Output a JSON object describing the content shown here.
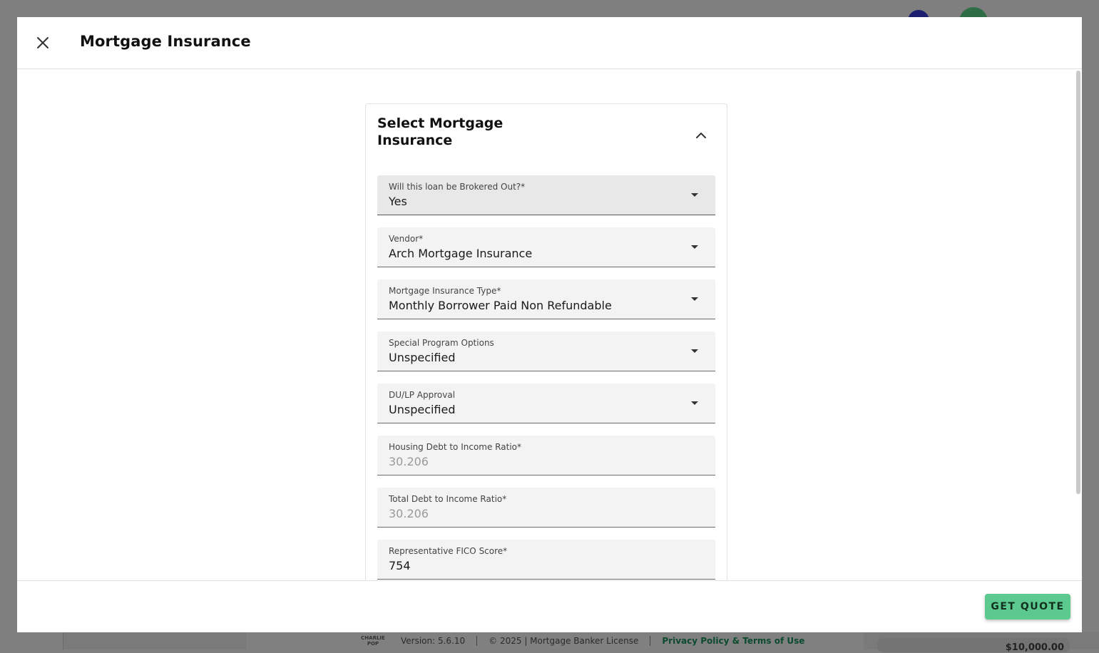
{
  "dialog": {
    "title": "Mortgage Insurance",
    "close_icon": "close-icon"
  },
  "card": {
    "title": "Select Mortgage Insurance",
    "collapse_icon": "chevron-up-icon"
  },
  "fields": {
    "brokered": {
      "label": "Will this loan be Brokered Out?*",
      "value": "Yes"
    },
    "vendor": {
      "label": "Vendor*",
      "value": "Arch Mortgage Insurance"
    },
    "mi_type": {
      "label": "Mortgage Insurance Type*",
      "value": "Monthly Borrower Paid Non Refundable"
    },
    "special_program": {
      "label": "Special Program Options",
      "value": "Unspecified"
    },
    "du_lp": {
      "label": "DU/LP Approval",
      "value": "Unspecified"
    },
    "housing_dti": {
      "label": "Housing Debt to Income Ratio*",
      "value": "30.206"
    },
    "total_dti": {
      "label": "Total Debt to Income Ratio*",
      "value": "30.206"
    },
    "fico": {
      "label": "Representative FICO Score*",
      "value": "754"
    }
  },
  "footer": {
    "quote_label": "GET QUOTE"
  },
  "background": {
    "logo_text": "CHARLIE POP",
    "version": "Version: 5.6.10",
    "copyright": "© 2025 | Mortgage Banker License",
    "policy_link": "Privacy Policy & Terms of Use",
    "total_amount": "$10,000.00"
  },
  "colors": {
    "accent": "#5cc98e",
    "overlay": "#7f7f7f"
  }
}
